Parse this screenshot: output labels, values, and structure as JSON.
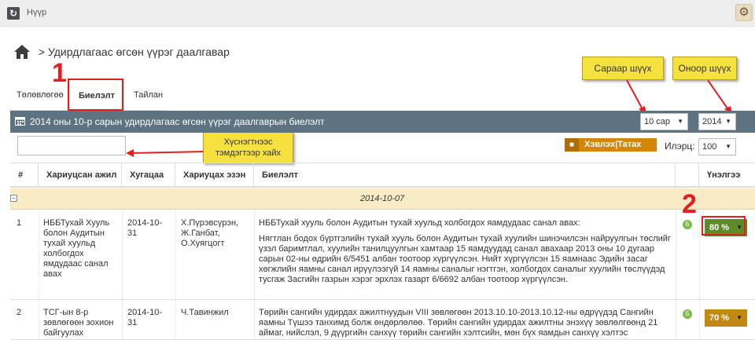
{
  "topbar": {
    "logo_icon": "refresh-icon",
    "home_label": "Нүүр",
    "settings_icon": "gear-icon"
  },
  "breadcrumb": {
    "text": "> Удирдлагаас өгсөн үүрэг даалгавар"
  },
  "tabs": [
    {
      "label": "Төлөвлөгөө",
      "active": false
    },
    {
      "label": "Биелэлт",
      "active": true
    },
    {
      "label": "Тайлан",
      "active": false
    }
  ],
  "annotations": {
    "step1": "1",
    "step2": "2",
    "callout_month": "Сараар шүүх",
    "callout_year": "Оноор шүүх",
    "callout_search": "Хүснэгтнээс тэмдэгтээр хайх"
  },
  "panel": {
    "title": "2014 оны 10-р сарын удирдлагаас өгсөн үүрэг даалгаврын биелэлт",
    "month_select": "10 сар",
    "year_select": "2014"
  },
  "toolbar": {
    "search_placeholder": "",
    "export_label": "Хэвлэх|Татах",
    "show_label": "Илэрц:",
    "show_value": "100"
  },
  "table": {
    "headers": [
      "#",
      "Хариуцсан ажил",
      "Хугацаа",
      "Хариуцах эзэн",
      "Биелэлт",
      "",
      "Үнэлгээ"
    ],
    "group_date": "2014-10-07",
    "rows": [
      {
        "num": "1",
        "task": "НББТухай Хууль болон Аудитын тухай хуульд холбогдох ямдудаас санал авах",
        "due": "2014-10-31",
        "responsible": "Х.Пүрэвсүрэн, Ж.Ганбат, О.Хуягцогт",
        "execution_title": "НББТухай хууль болон Аудитын тухай хуульд холбогдох яамдудаас санал авах:",
        "execution_body": "Нягтлан бодох бүртгэлийн тухай хууль болон Аудитын тухай хуулийн шинэчилсэн найруулгын төслийг үзэл баримтлал, хуулийн танилцуулгын хамтаар 15 яамдуудад санал авахаар 2013 оны 10 дугаар сарын 02-ны өдрийн 6/5451 албан тоотоор хүргүүлсэн. Нийт хүргүүлсэн 15 яамнаас Эдийн засаг хөгжлийн яамны санал ирүүлээгүй 14 яамны саналыг нэгтгэн, холбогдох саналыг хуулийн төслүүдэд тусгаж Засгийн газрын хэрэг эрхлэх газарт 6/6692 албан тоотоор хүргүүлсэн.",
        "badge": "Б",
        "rating": "80 %",
        "rating_color": "#5e8a2a"
      },
      {
        "num": "2",
        "task": "ТСГ-ын 8-р зөвлөгөөн зохион байгуулах",
        "due": "2014-10-31",
        "responsible": "Ч.Тавинжил",
        "execution_title": "Төрийн сангийн удирдах ажилтнуудын VIII зөвлөгөөн 2013.10.10-2013.10.12-ны өдрүүдэд Сангийн яамны Түшээ танхимд болж өндөрлөлөө. Төрийн сангийн удирдах ажилтны энэхүү зөвлөлгөөнд 21 аймаг, нийслэл, 9 дүүргийн санхүү төрийн сангийн хэлтсийн, мөн бүх яамдын санхүү хэлтэс",
        "execution_body": "",
        "badge": "Б",
        "rating": "70 %",
        "rating_color": "#c28a14"
      }
    ]
  }
}
